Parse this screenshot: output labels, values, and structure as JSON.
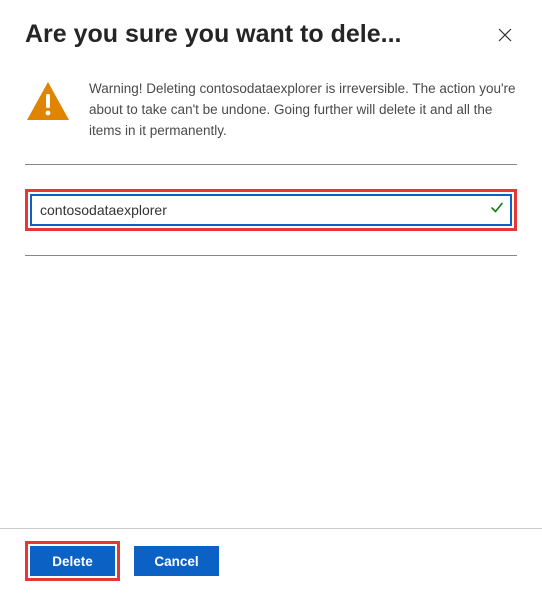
{
  "header": {
    "title": "Are you sure you want to dele..."
  },
  "warning": {
    "text": "Warning! Deleting contosodataexplorer is irreversible. The action you're about to take can't be undone. Going further will delete it and all the items in it permanently."
  },
  "input": {
    "value": "contosodataexplorer"
  },
  "footer": {
    "delete_label": "Delete",
    "cancel_label": "Cancel"
  },
  "colors": {
    "highlight": "#e63737",
    "primary": "#0b61c4",
    "warning": "#e08400"
  }
}
